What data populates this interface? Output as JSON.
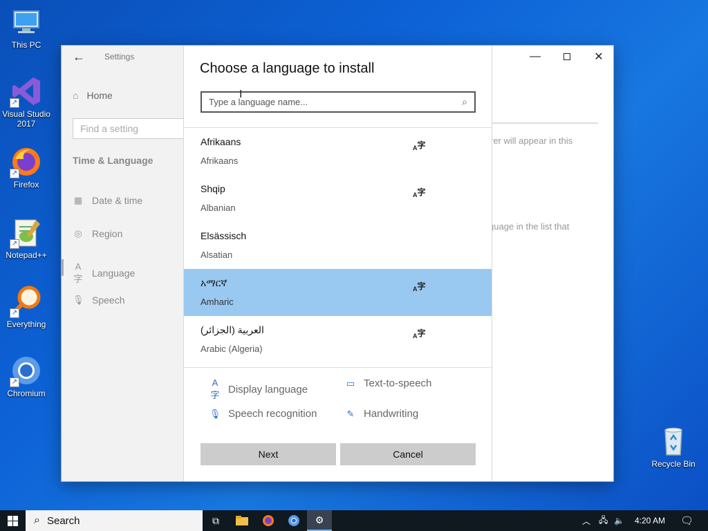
{
  "desktop": {
    "icons": [
      {
        "label": "This PC"
      },
      {
        "label": "Visual Studio 2017"
      },
      {
        "label": "Firefox"
      },
      {
        "label": "Notepad++"
      },
      {
        "label": "Everything"
      },
      {
        "label": "Chromium"
      },
      {
        "label": "Recycle Bin"
      }
    ]
  },
  "settings": {
    "app_title": "Settings",
    "home_label": "Home",
    "find_placeholder": "Find a setting",
    "section_heading": "Time & Language",
    "nav": [
      {
        "label": "Date & time",
        "icon": "calendar-clock-icon"
      },
      {
        "label": "Region",
        "icon": "globe-icon"
      },
      {
        "label": "Language",
        "icon": "language-icon"
      },
      {
        "label": "Speech",
        "icon": "microphone-icon"
      }
    ],
    "bg_text_1": "rer will appear in this",
    "bg_text_2": "guage in the list that"
  },
  "dialog": {
    "title": "Choose a language to install",
    "search_placeholder": "Type a language name...",
    "languages": [
      {
        "native": "Afrikaans",
        "english": "Afrikaans",
        "selected": false
      },
      {
        "native": "Shqip",
        "english": "Albanian",
        "selected": false
      },
      {
        "native": "Elsässisch",
        "english": "Alsatian",
        "selected": false
      },
      {
        "native": "አማርኛ",
        "english": "Amharic",
        "selected": true
      },
      {
        "native": "العربية (الجزائر)",
        "english": "Arabic (Algeria)",
        "selected": false
      }
    ],
    "features": {
      "display_language": "Display language",
      "text_to_speech": "Text-to-speech",
      "speech_recognition": "Speech recognition",
      "handwriting": "Handwriting"
    },
    "next_label": "Next",
    "cancel_label": "Cancel"
  },
  "taskbar": {
    "search_label": "Search",
    "clock": "4:20 AM"
  },
  "colors": {
    "selection": "#99c8f0",
    "accent": "#2a6fc9"
  }
}
